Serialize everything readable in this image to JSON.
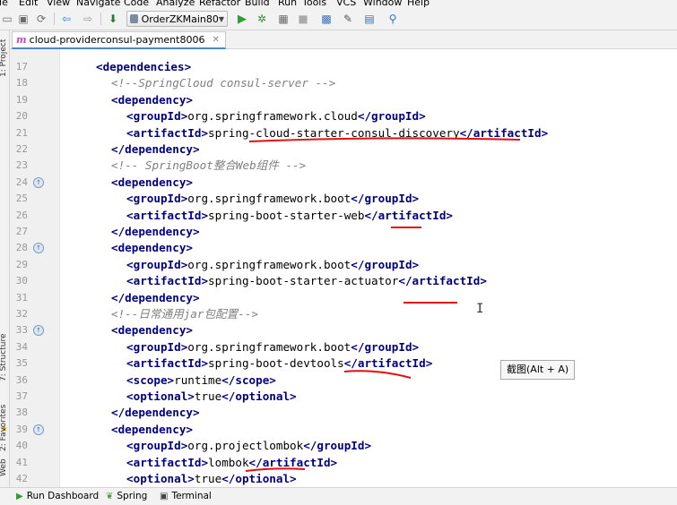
{
  "menu": [
    "ile",
    "Edit",
    "View",
    "Navigate",
    "Code",
    "Analyze",
    "Refactor",
    "Build",
    "Run",
    "Tools",
    "VCS",
    "Window",
    "Help"
  ],
  "toolbar": {
    "run_config": "OrderZKMain80"
  },
  "tab": {
    "icon_letter": "m",
    "title": "cloud-providerconsul-payment8006"
  },
  "side_labels": {
    "project": "1: Project",
    "structure": "7: Structure",
    "favorites": "2: Favorites",
    "web": "Web"
  },
  "lines": [
    {
      "n": "17",
      "indent": 4,
      "parts": [
        [
          "t",
          "<dependencies>"
        ]
      ]
    },
    {
      "n": "18",
      "indent": 6,
      "parts": [
        [
          "c",
          "<!--SpringCloud consul-server -->"
        ]
      ]
    },
    {
      "n": "19",
      "indent": 6,
      "parts": [
        [
          "t",
          "<dependency>"
        ]
      ]
    },
    {
      "n": "20",
      "indent": 8,
      "parts": [
        [
          "t",
          "<groupId>"
        ],
        [
          "p",
          "org.springframework.cloud"
        ],
        [
          "t",
          "</groupId>"
        ]
      ]
    },
    {
      "n": "21",
      "indent": 8,
      "parts": [
        [
          "t",
          "<artifactId>"
        ],
        [
          "p",
          "spring-cloud-starter-consul-discovery"
        ],
        [
          "t",
          "</artifactId>"
        ]
      ]
    },
    {
      "n": "22",
      "indent": 6,
      "parts": [
        [
          "t",
          "</dependency>"
        ]
      ]
    },
    {
      "n": "23",
      "indent": 6,
      "parts": [
        [
          "c",
          "<!-- SpringBoot整合Web组件 -->"
        ]
      ]
    },
    {
      "n": "24",
      "indent": 6,
      "parts": [
        [
          "t",
          "<dependency>"
        ]
      ]
    },
    {
      "n": "25",
      "indent": 8,
      "parts": [
        [
          "t",
          "<groupId>"
        ],
        [
          "p",
          "org.springframework.boot"
        ],
        [
          "t",
          "</groupId>"
        ]
      ]
    },
    {
      "n": "26",
      "indent": 8,
      "parts": [
        [
          "t",
          "<artifactId>"
        ],
        [
          "p",
          "spring-boot-starter-web"
        ],
        [
          "t",
          "</artifactId>"
        ]
      ]
    },
    {
      "n": "27",
      "indent": 6,
      "parts": [
        [
          "t",
          "</dependency>"
        ]
      ]
    },
    {
      "n": "28",
      "indent": 6,
      "parts": [
        [
          "t",
          "<dependency>"
        ]
      ]
    },
    {
      "n": "29",
      "indent": 8,
      "parts": [
        [
          "t",
          "<groupId>"
        ],
        [
          "p",
          "org.springframework.boot"
        ],
        [
          "t",
          "</groupId>"
        ]
      ]
    },
    {
      "n": "30",
      "indent": 8,
      "parts": [
        [
          "t",
          "<artifactId>"
        ],
        [
          "p",
          "spring-boot-starter-actuator"
        ],
        [
          "t",
          "</artifactId>"
        ]
      ]
    },
    {
      "n": "31",
      "indent": 6,
      "parts": [
        [
          "t",
          "</dependency>"
        ]
      ]
    },
    {
      "n": "32",
      "indent": 6,
      "parts": [
        [
          "c",
          "<!--日常通用jar包配置-->"
        ]
      ]
    },
    {
      "n": "33",
      "indent": 6,
      "parts": [
        [
          "t",
          "<dependency>"
        ]
      ]
    },
    {
      "n": "34",
      "indent": 8,
      "parts": [
        [
          "t",
          "<groupId>"
        ],
        [
          "p",
          "org.springframework.boot"
        ],
        [
          "t",
          "</groupId>"
        ]
      ]
    },
    {
      "n": "35",
      "indent": 8,
      "parts": [
        [
          "t",
          "<artifactId>"
        ],
        [
          "p",
          "spring-boot-devtools"
        ],
        [
          "t",
          "</artifactId>"
        ]
      ]
    },
    {
      "n": "36",
      "indent": 8,
      "parts": [
        [
          "t",
          "<scope>"
        ],
        [
          "p",
          "runtime"
        ],
        [
          "t",
          "</scope>"
        ]
      ]
    },
    {
      "n": "37",
      "indent": 8,
      "parts": [
        [
          "t",
          "<optional>"
        ],
        [
          "p",
          "true"
        ],
        [
          "t",
          "</optional>"
        ]
      ]
    },
    {
      "n": "38",
      "indent": 6,
      "parts": [
        [
          "t",
          "</dependency>"
        ]
      ]
    },
    {
      "n": "39",
      "indent": 6,
      "parts": [
        [
          "t",
          "<dependency>"
        ]
      ]
    },
    {
      "n": "40",
      "indent": 8,
      "parts": [
        [
          "t",
          "<groupId>"
        ],
        [
          "p",
          "org.projectlombok"
        ],
        [
          "t",
          "</groupId>"
        ]
      ]
    },
    {
      "n": "41",
      "indent": 8,
      "parts": [
        [
          "t",
          "<artifactId>"
        ],
        [
          "p",
          "lombok"
        ],
        [
          "t",
          "</artifactId>"
        ]
      ]
    },
    {
      "n": "42",
      "indent": 8,
      "parts": [
        [
          "t",
          "<optional>"
        ],
        [
          "p",
          "true"
        ],
        [
          "t",
          "</optional>"
        ]
      ]
    }
  ],
  "gutter_icons": [
    "24",
    "28",
    "33",
    "39"
  ],
  "tooltip": "截图(Alt + A)",
  "bottom": {
    "run_dashboard": "Run Dashboard",
    "spring": "Spring",
    "terminal": "Terminal"
  },
  "colors": {
    "tag": "#000080",
    "comment": "#808080",
    "annotation": "#e01010"
  }
}
